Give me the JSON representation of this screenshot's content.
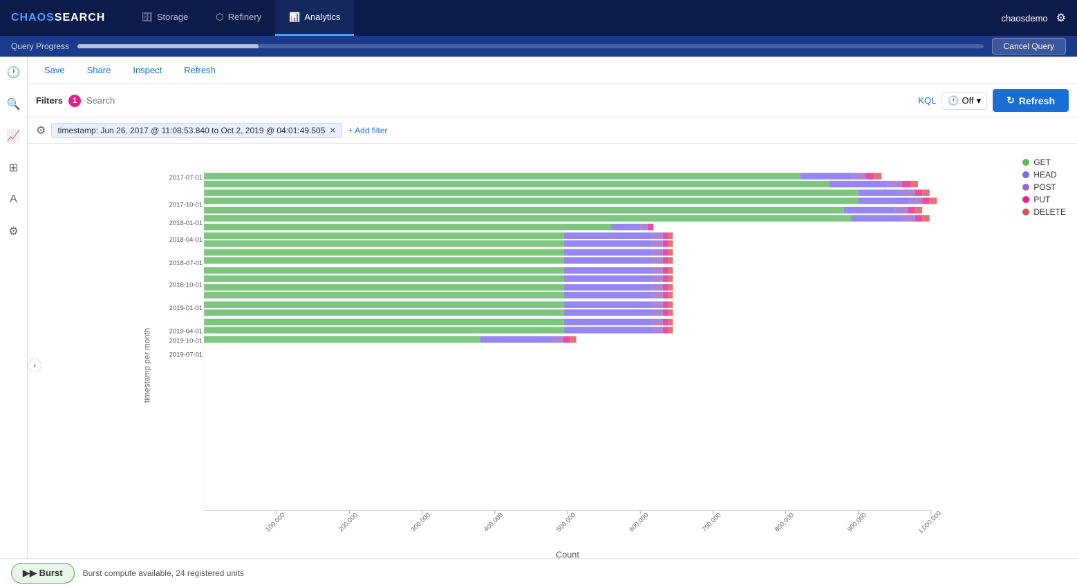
{
  "app": {
    "logo_chaos": "CHAOS",
    "logo_search": "SEARCH",
    "user": "chaosdemo"
  },
  "nav": {
    "items": [
      {
        "id": "storage",
        "label": "Storage",
        "icon": "🗄",
        "active": false
      },
      {
        "id": "refinery",
        "label": "Refinery",
        "icon": "⬡",
        "active": false
      },
      {
        "id": "analytics",
        "label": "Analytics",
        "icon": "📊",
        "active": true
      }
    ]
  },
  "query_progress": {
    "label": "Query Progress",
    "cancel_label": "Cancel Query"
  },
  "toolbar": {
    "save_label": "Save",
    "share_label": "Share",
    "inspect_label": "Inspect",
    "refresh_label": "Refresh"
  },
  "filter_bar": {
    "filters_label": "Filters",
    "filter_count": "1",
    "search_placeholder": "Search",
    "kql_label": "KQL",
    "time_value": "Off",
    "refresh_label": "Refresh"
  },
  "active_filter": {
    "settings_icon": "⚙",
    "filter_text": "timestamp: Jun 26, 2017 @ 11:08:53.840 to Oct 2, 2019 @ 04:01:49.505",
    "add_filter_label": "+ Add filter"
  },
  "chart": {
    "y_axis_label": "timestamp per month",
    "x_axis_label": "Count",
    "y_labels": [
      "2017-07-01",
      "2017-10-01",
      "2018-01-01",
      "2018-04-01",
      "2018-07-01",
      "2018-10-01",
      "2019-01-01",
      "2019-04-01",
      "2019-07-01",
      "2019-10-01"
    ],
    "x_labels": [
      "100,000",
      "200,000",
      "300,000",
      "400,000",
      "500,000",
      "600,000",
      "700,000",
      "800,000",
      "900,000",
      "1,000,000"
    ],
    "legend": [
      {
        "label": "GET",
        "color": "#5cb85c"
      },
      {
        "label": "HEAD",
        "color": "#7b68ee"
      },
      {
        "label": "POST",
        "color": "#9966cc"
      },
      {
        "label": "PUT",
        "color": "#e91e8c"
      },
      {
        "label": "DELETE",
        "color": "#d9534f"
      }
    ],
    "bars": [
      {
        "date": "2017-07-01",
        "get": 0.82,
        "head": 0.07,
        "post": 0.02,
        "put": 0.01,
        "delete": 0.01
      },
      {
        "date": "2017-07-01b",
        "get": 0.86,
        "head": 0.08,
        "post": 0.02,
        "put": 0.01,
        "delete": 0.01
      },
      {
        "date": "2017-10-01",
        "get": 0.9,
        "head": 0.06,
        "post": 0.02,
        "put": 0.01,
        "delete": 0.01
      },
      {
        "date": "2017-10-01b",
        "get": 0.9,
        "head": 0.07,
        "post": 0.02,
        "put": 0.01,
        "delete": 0.01
      },
      {
        "date": "2018-01-01",
        "get": 0.88,
        "head": 0.07,
        "post": 0.02,
        "put": 0.01,
        "delete": 0.01
      },
      {
        "date": "2018-01-01b",
        "get": 0.89,
        "head": 0.07,
        "post": 0.02,
        "put": 0.01,
        "delete": 0.01
      },
      {
        "date": "2018-01-01c",
        "get": 0.56,
        "head": 0.04,
        "post": 0.01,
        "put": 0.005,
        "delete": 0.005
      },
      {
        "date": "2018-04-01",
        "get": 0.5,
        "head": 0.12,
        "post": 0.02,
        "put": 0.01,
        "delete": 0.01
      },
      {
        "date": "2018-04-01b",
        "get": 0.5,
        "head": 0.12,
        "post": 0.02,
        "put": 0.01,
        "delete": 0.01
      },
      {
        "date": "2018-07-01",
        "get": 0.5,
        "head": 0.12,
        "post": 0.02,
        "put": 0.01,
        "delete": 0.01
      },
      {
        "date": "2018-07-01b",
        "get": 0.5,
        "head": 0.12,
        "post": 0.02,
        "put": 0.01,
        "delete": 0.01
      },
      {
        "date": "2018-10-01",
        "get": 0.5,
        "head": 0.12,
        "post": 0.02,
        "put": 0.01,
        "delete": 0.01
      },
      {
        "date": "2018-10-01b",
        "get": 0.5,
        "head": 0.12,
        "post": 0.02,
        "put": 0.01,
        "delete": 0.01
      },
      {
        "date": "2019-01-01",
        "get": 0.5,
        "head": 0.12,
        "post": 0.02,
        "put": 0.01,
        "delete": 0.01
      },
      {
        "date": "2019-01-01b",
        "get": 0.5,
        "head": 0.12,
        "post": 0.02,
        "put": 0.01,
        "delete": 0.01
      },
      {
        "date": "2019-04-01",
        "get": 0.5,
        "head": 0.12,
        "post": 0.02,
        "put": 0.01,
        "delete": 0.01
      },
      {
        "date": "2019-04-01b",
        "get": 0.5,
        "head": 0.12,
        "post": 0.02,
        "put": 0.01,
        "delete": 0.01
      },
      {
        "date": "2019-07-01",
        "get": 0.5,
        "head": 0.12,
        "post": 0.02,
        "put": 0.01,
        "delete": 0.01
      },
      {
        "date": "2019-07-01b",
        "get": 0.5,
        "head": 0.12,
        "post": 0.02,
        "put": 0.01,
        "delete": 0.01
      },
      {
        "date": "2019-10-01",
        "get": 0.38,
        "head": 0.1,
        "post": 0.02,
        "put": 0.01,
        "delete": 0.01
      }
    ]
  },
  "bottom": {
    "list_icon": "☰"
  },
  "footer": {
    "burst_label": "▶▶ Burst",
    "burst_info": "Burst compute available, 24 registered units"
  }
}
